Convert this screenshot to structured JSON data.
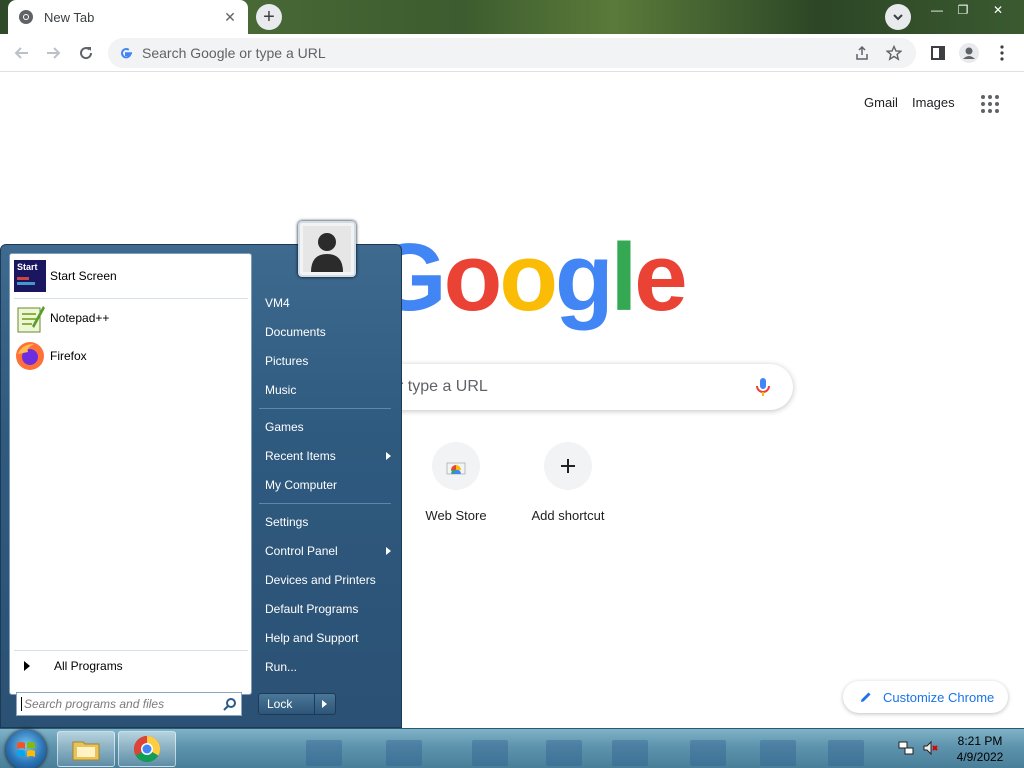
{
  "browser": {
    "tab_title": "New Tab",
    "tab_close": "✕",
    "new_tab": "+",
    "window_controls": {
      "minimize": "—",
      "restore": "❐",
      "close": "✕"
    }
  },
  "toolbar": {
    "omnibox_placeholder": "Search Google or type a URL"
  },
  "ntp": {
    "top_links": [
      "Gmail",
      "Images"
    ],
    "logo_text": [
      "G",
      "o",
      "o",
      "g",
      "l",
      "e"
    ],
    "logo_colors": [
      "#4285F4",
      "#EA4335",
      "#FBBC05",
      "#4285F4",
      "#34A853",
      "#EA4335"
    ],
    "search_placeholder_visible": "r type a URL",
    "shortcuts": [
      {
        "label": "Web Store",
        "icon": "webstore-icon"
      },
      {
        "label": "Add shortcut",
        "icon": "plus-icon"
      }
    ],
    "customize_label": "Customize Chrome"
  },
  "start_menu": {
    "pinned": [
      {
        "label": "Start Screen",
        "icon": "start-screen-icon"
      },
      {
        "label": "Notepad++",
        "icon": "notepadpp-icon"
      },
      {
        "label": "Firefox",
        "icon": "firefox-icon"
      }
    ],
    "all_programs": "All Programs",
    "search_placeholder": "Search programs and files",
    "right_items": [
      {
        "label": "VM4",
        "submenu": false
      },
      {
        "label": "Documents",
        "submenu": false
      },
      {
        "label": "Pictures",
        "submenu": false
      },
      {
        "label": "Music",
        "submenu": false
      },
      {
        "label": "Games",
        "submenu": false
      },
      {
        "label": "Recent Items",
        "submenu": true
      },
      {
        "label": "My Computer",
        "submenu": false
      },
      {
        "label": "Settings",
        "submenu": false
      },
      {
        "label": "Control Panel",
        "submenu": true
      },
      {
        "label": "Devices and Printers",
        "submenu": false
      },
      {
        "label": "Default Programs",
        "submenu": false
      },
      {
        "label": "Help and Support",
        "submenu": false
      },
      {
        "label": "Run...",
        "submenu": false
      }
    ],
    "lock_label": "Lock",
    "start_screen_tile_text": "Start"
  },
  "taskbar": {
    "pinned": [
      "file-explorer-icon",
      "chrome-icon"
    ],
    "clock_time": "8:21 PM",
    "clock_date": "4/9/2022"
  },
  "colors": {
    "accent": "#1a73e8",
    "start_menu_blue": "#2f5a7f"
  }
}
